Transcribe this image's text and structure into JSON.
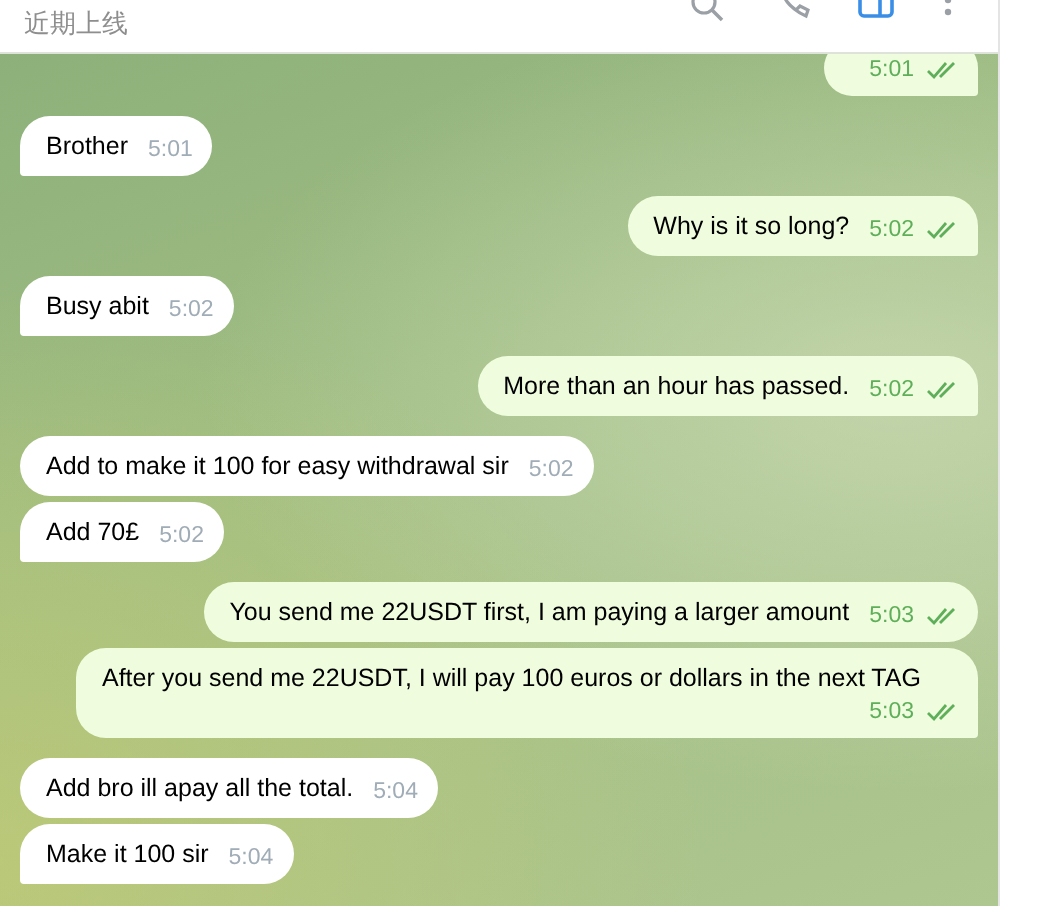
{
  "header": {
    "status": "近期上线"
  },
  "messages": [
    {
      "kind": "sent",
      "time": "5:01",
      "read": true
    },
    {
      "kind": "received",
      "text": "Brother",
      "time": "5:01"
    },
    {
      "kind": "sent",
      "text": "Why is it so long?",
      "time": "5:02",
      "read": true
    },
    {
      "kind": "received",
      "text": "Busy abit",
      "time": "5:02"
    },
    {
      "kind": "sent",
      "text": "More than an hour has passed.",
      "time": "5:02",
      "read": true
    },
    {
      "kind": "received",
      "text": "Add to make it 100 for easy withdrawal sir",
      "time": "5:02"
    },
    {
      "kind": "received",
      "text": "Add 70£",
      "time": "5:02"
    },
    {
      "kind": "sent",
      "text": "You send me 22USDT first, I am paying a larger amount",
      "time": "5:03",
      "read": true
    },
    {
      "kind": "sent",
      "text": "After you send me 22USDT, I will pay 100 euros or dollars in the next TAG",
      "time": "5:03",
      "read": true
    },
    {
      "kind": "received",
      "text": "Add bro ill apay all the total.",
      "time": "5:04"
    },
    {
      "kind": "received",
      "text": "Make it 100 sir",
      "time": "5:04"
    }
  ]
}
